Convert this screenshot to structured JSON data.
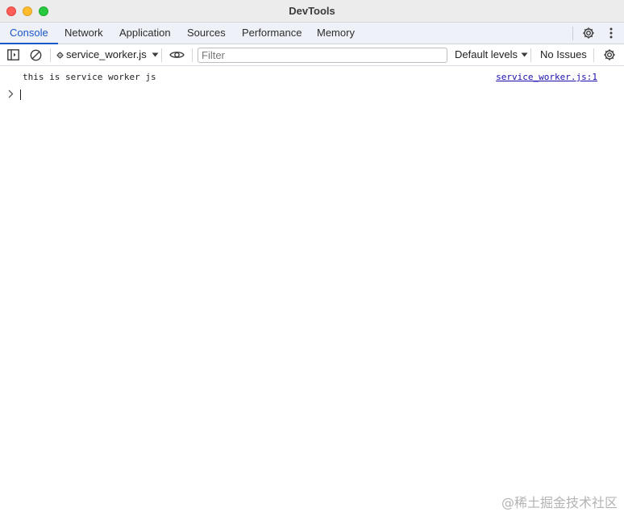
{
  "window": {
    "title": "DevTools"
  },
  "tabs": [
    {
      "label": "Console",
      "active": true
    },
    {
      "label": "Network"
    },
    {
      "label": "Application"
    },
    {
      "label": "Sources"
    },
    {
      "label": "Performance"
    },
    {
      "label": "Memory"
    }
  ],
  "toolbar": {
    "context": "service_worker.js",
    "filter_placeholder": "Filter",
    "filter_value": "",
    "levels": "Default levels",
    "issues": "No Issues"
  },
  "console": {
    "messages": [
      {
        "text": "this is service worker js",
        "source": "service_worker.js:1"
      }
    ]
  },
  "watermark": "@稀土掘金技术社区",
  "colors": {
    "accent": "#1a56c9",
    "link": "#1a0dab",
    "tabbar_bg": "#eef1f7"
  },
  "icons": [
    "settings-gear-icon",
    "kebab-menu-icon",
    "sidebar-toggle-icon",
    "clear-console-icon",
    "gear-small-icon",
    "chevron-down-icon",
    "eye-icon",
    "chevron-right-icon"
  ]
}
